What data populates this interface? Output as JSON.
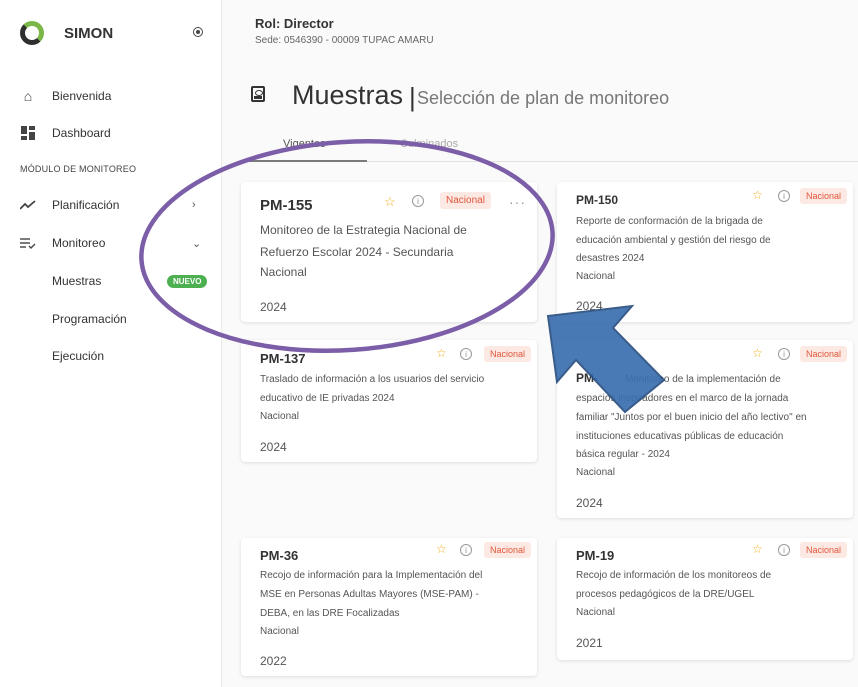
{
  "app": {
    "name": "SIMON"
  },
  "header": {
    "role": "Rol: Director",
    "sede": "Sede: 0546390 - 00009 TUPAC AMARU"
  },
  "sidebar": {
    "items": [
      {
        "label": "Bienvenida"
      },
      {
        "label": "Dashboard"
      },
      {
        "label": "Planificación"
      },
      {
        "label": "Monitoreo"
      },
      {
        "label": "Muestras"
      },
      {
        "label": "Programación"
      },
      {
        "label": "Ejecución"
      }
    ],
    "section_label": "MÓDULO DE MONITOREO",
    "new_badge": "NUEVO"
  },
  "page": {
    "title": "Muestras",
    "separator": "|",
    "subtitle": "Selección de plan de monitoreo"
  },
  "tabs": [
    {
      "label": "Vigentes"
    },
    {
      "label": "Culminados"
    }
  ],
  "cards": [
    {
      "code": "PM-155",
      "tag": "Nacional",
      "desc1": "Monitoreo de la Estrategia Nacional de",
      "desc2": "Refuerzo Escolar 2024 - Secundaria",
      "scope": "Nacional",
      "year": "2024",
      "more": "···"
    },
    {
      "code": "PM-150",
      "tag": "Nacional",
      "desc1": "Reporte de conformación de la brigada de",
      "desc2": "educación ambiental y gestión del riesgo de",
      "desc3": "desastres 2024",
      "scope": "Nacional",
      "year": "2024"
    },
    {
      "code": "PM-137",
      "tag": "Nacional",
      "desc1": "Traslado de información a los usuarios del servicio",
      "desc2": "educativo de IE privadas 2024",
      "scope": "Nacional",
      "year": "2024"
    },
    {
      "code": "PM-",
      "tag": "Nacional",
      "desc1": "Monitoreo de la implementación de",
      "desc2": "espacios inspiradores en el marco de la jornada",
      "desc3": "familiar \"Juntos por el buen inicio del año lectivo\" en",
      "desc4": "instituciones educativas públicas de educación",
      "desc5": "básica regular - 2024",
      "scope": "Nacional",
      "year": "2024"
    },
    {
      "code": "PM-36",
      "tag": "Nacional",
      "desc1": "Recojo de información para la Implementación del",
      "desc2": "MSE en Personas Adultas Mayores (MSE-PAM) -",
      "desc3": "DEBA, en las DRE Focalizadas",
      "scope": "Nacional",
      "year": "2022"
    },
    {
      "code": "PM-19",
      "tag": "Nacional",
      "desc1": "Recojo de información de los monitoreos de",
      "desc2": "procesos pedagógicos de la DRE/UGEL",
      "scope": "Nacional",
      "year": "2021"
    }
  ],
  "colors": {
    "accent_green": "#4caf50",
    "tag_text": "#e0563a",
    "tag_bg": "#fde9e3",
    "annotation_purple": "#7b5ea7",
    "annotation_blue": "#3a6fb0"
  }
}
